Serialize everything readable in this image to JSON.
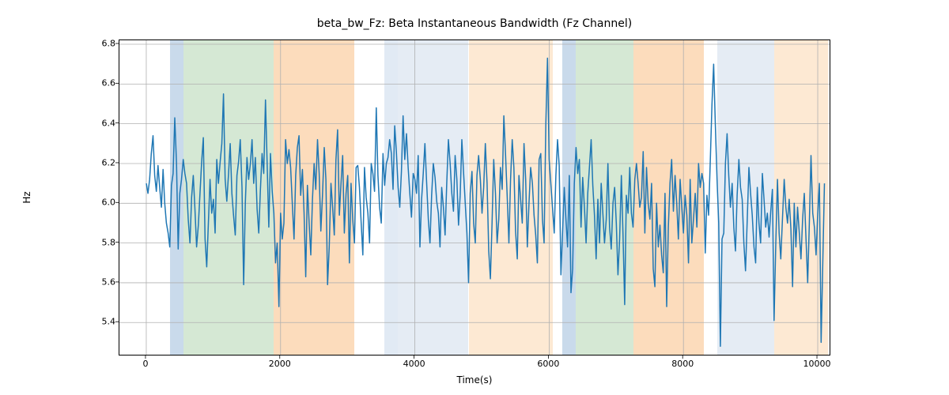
{
  "chart_data": {
    "type": "line",
    "title": "beta_bw_Fz: Beta Instantaneous Bandwidth (Fz Channel)",
    "xlabel": "Time(s)",
    "ylabel": "Hz",
    "xlim": [
      -400,
      10200
    ],
    "ylim": [
      5.23,
      6.82
    ],
    "xticks": [
      0,
      2000,
      4000,
      6000,
      8000,
      10000
    ],
    "yticks": [
      5.4,
      5.6,
      5.8,
      6.0,
      6.2,
      6.4,
      6.6,
      6.8
    ],
    "bands": [
      {
        "x0": 350,
        "x1": 550,
        "color": "#c3d6e9",
        "opacity": 0.9
      },
      {
        "x0": 550,
        "x1": 1900,
        "color": "#d0e6cf",
        "opacity": 0.9
      },
      {
        "x0": 1900,
        "x1": 3100,
        "color": "#fcd8b5",
        "opacity": 0.9
      },
      {
        "x0": 3550,
        "x1": 3750,
        "color": "#c3d6e9",
        "opacity": 0.5
      },
      {
        "x0": 3750,
        "x1": 4800,
        "color": "#e2eaf3",
        "opacity": 0.9
      },
      {
        "x0": 4800,
        "x1": 6050,
        "color": "#fde7ce",
        "opacity": 0.9
      },
      {
        "x0": 6200,
        "x1": 6400,
        "color": "#c3d6e9",
        "opacity": 0.9
      },
      {
        "x0": 6400,
        "x1": 7250,
        "color": "#d0e6cf",
        "opacity": 0.9
      },
      {
        "x0": 7250,
        "x1": 8300,
        "color": "#fcd8b5",
        "opacity": 0.9
      },
      {
        "x0": 8500,
        "x1": 9350,
        "color": "#e2eaf3",
        "opacity": 0.9
      },
      {
        "x0": 9350,
        "x1": 10150,
        "color": "#fde7ce",
        "opacity": 0.9
      }
    ],
    "series": [
      {
        "name": "beta_bw_Fz",
        "color": "#1f77b4",
        "x_step": 25,
        "x_start": 0,
        "y": [
          6.1,
          6.05,
          6.12,
          6.25,
          6.34,
          6.14,
          6.06,
          6.19,
          6.08,
          5.98,
          6.17,
          6.0,
          5.9,
          5.85,
          5.78,
          6.09,
          6.15,
          6.43,
          6.2,
          5.77,
          6.05,
          6.12,
          6.22,
          6.15,
          6.1,
          5.92,
          5.8,
          6.03,
          6.14,
          5.97,
          5.78,
          5.89,
          6.05,
          6.21,
          6.33,
          5.82,
          5.68,
          5.9,
          6.12,
          5.95,
          6.02,
          5.85,
          6.22,
          6.1,
          6.21,
          6.3,
          6.55,
          6.12,
          6.01,
          6.15,
          6.3,
          6.05,
          5.94,
          5.84,
          6.14,
          6.21,
          6.32,
          6.08,
          5.59,
          6.0,
          6.23,
          6.12,
          6.2,
          6.32,
          6.1,
          6.23,
          5.97,
          5.85,
          6.07,
          6.25,
          6.15,
          6.52,
          6.2,
          5.88,
          6.25,
          6.06,
          5.95,
          5.7,
          5.8,
          5.48,
          5.95,
          5.82,
          5.9,
          6.32,
          6.2,
          6.27,
          6.18,
          6.0,
          5.82,
          6.14,
          6.28,
          6.34,
          6.04,
          6.17,
          5.95,
          5.63,
          6.09,
          5.9,
          5.74,
          6.02,
          6.2,
          6.07,
          6.32,
          6.15,
          5.86,
          6.04,
          6.28,
          6.12,
          5.59,
          5.78,
          6.1,
          5.98,
          5.84,
          6.22,
          6.37,
          5.94,
          6.1,
          6.24,
          5.85,
          6.05,
          6.14,
          5.7,
          6.1,
          5.92,
          5.8,
          6.18,
          6.19,
          6.08,
          5.9,
          5.74,
          6.18,
          6.03,
          5.95,
          5.8,
          6.2,
          6.15,
          6.06,
          6.48,
          6.14,
          5.98,
          5.9,
          6.25,
          6.09,
          6.2,
          6.23,
          6.32,
          6.25,
          6.07,
          6.39,
          6.26,
          6.08,
          5.98,
          6.16,
          6.44,
          6.22,
          6.35,
          6.18,
          6.05,
          5.93,
          6.15,
          6.12,
          6.05,
          6.24,
          5.78,
          6.02,
          6.15,
          6.3,
          6.11,
          5.92,
          5.8,
          6.04,
          6.2,
          6.13,
          6.01,
          5.95,
          5.78,
          6.08,
          5.98,
          5.84,
          6.1,
          6.32,
          6.2,
          6.05,
          5.96,
          6.24,
          6.12,
          5.89,
          6.04,
          6.32,
          6.16,
          6.0,
          5.85,
          5.6,
          6.05,
          6.16,
          5.9,
          5.8,
          6.14,
          6.24,
          6.12,
          5.95,
          6.08,
          6.3,
          6.1,
          5.76,
          5.62,
          5.9,
          6.22,
          6.05,
          5.8,
          5.92,
          6.18,
          6.07,
          6.44,
          6.25,
          6.04,
          5.8,
          6.12,
          6.32,
          6.18,
          5.86,
          5.72,
          6.14,
          6.02,
          5.9,
          6.3,
          6.12,
          5.78,
          6.0,
          6.18,
          6.1,
          5.94,
          5.84,
          5.7,
          6.22,
          6.25,
          5.92,
          5.8,
          6.4,
          6.73,
          6.22,
          6.1,
          5.98,
          5.85,
          6.14,
          6.32,
          6.19,
          5.64,
          5.86,
          6.08,
          5.92,
          5.78,
          6.14,
          5.55,
          5.67,
          6.1,
          6.28,
          6.15,
          6.22,
          5.88,
          6.13,
          5.98,
          5.8,
          6.05,
          6.18,
          6.32,
          6.09,
          5.94,
          5.72,
          6.02,
          5.8,
          6.1,
          5.95,
          5.8,
          5.92,
          6.2,
          5.88,
          5.77,
          6.0,
          6.08,
          5.9,
          5.64,
          5.82,
          6.14,
          5.84,
          5.49,
          6.04,
          5.95,
          6.18,
          5.95,
          5.88,
          6.12,
          6.2,
          6.1,
          5.98,
          6.03,
          6.26,
          5.85,
          6.18,
          6.0,
          5.92,
          6.1,
          5.67,
          5.58,
          6.0,
          5.78,
          5.89,
          5.74,
          5.65,
          6.05,
          5.48,
          5.88,
          6.1,
          6.22,
          5.96,
          6.14,
          6.0,
          5.82,
          6.12,
          5.98,
          5.85,
          6.04,
          5.94,
          5.7,
          6.12,
          5.8,
          5.92,
          6.05,
          5.88,
          6.2,
          6.08,
          6.15,
          6.1,
          5.75,
          6.04,
          5.94,
          6.22,
          6.5,
          6.7,
          6.4,
          6.12,
          5.9,
          5.28,
          5.82,
          5.85,
          6.2,
          6.35,
          6.14,
          5.98,
          6.1,
          5.88,
          5.76,
          6.04,
          6.22,
          6.08,
          6.02,
          5.8,
          5.66,
          5.92,
          6.18,
          6.05,
          5.94,
          5.78,
          5.7,
          6.08,
          5.9,
          5.8,
          6.15,
          6.02,
          5.88,
          5.95,
          5.83,
          5.96,
          6.07,
          5.41,
          5.8,
          6.12,
          5.85,
          5.72,
          5.92,
          6.12,
          5.98,
          5.9,
          6.02,
          5.87,
          5.58,
          6.0,
          5.78,
          5.98,
          5.85,
          5.72,
          5.92,
          6.05,
          5.82,
          5.6,
          5.9,
          6.24,
          5.95,
          5.88,
          5.74,
          5.95,
          6.1,
          5.3,
          5.7,
          6.1
        ]
      }
    ]
  }
}
